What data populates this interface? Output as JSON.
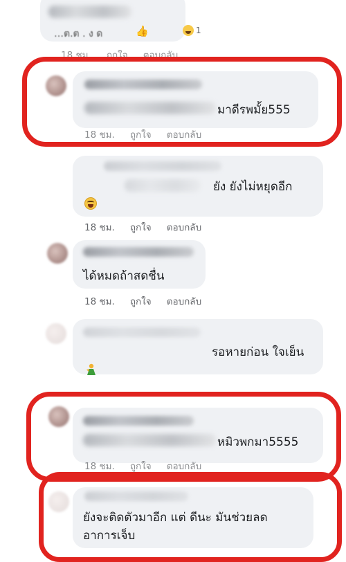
{
  "comments": [
    {
      "id": "c0",
      "text": "…ต.ต . ง ด",
      "emoji": "👍",
      "reaction_count": "1",
      "meta": {
        "time": "18 ชม.",
        "like": "ถูกใจ",
        "reply": "ตอบกลับ"
      }
    },
    {
      "id": "c1",
      "text": "มาดีรพมั้ย555",
      "meta": {
        "time": "18 ชม.",
        "like": "ถูกใจ",
        "reply": "ตอบกลับ"
      },
      "highlighted": true
    },
    {
      "id": "c2",
      "text": "ยัง ยังไม่หยุดอีก",
      "emoji_name": "laughing-face",
      "meta": {
        "time": "18 ชม.",
        "like": "ถูกใจ",
        "reply": "ตอบกลับ"
      }
    },
    {
      "id": "c3",
      "text": "ได้หมดถ้าสดชื่น",
      "meta": {
        "time": "18 ชม.",
        "like": "ถูกใจ",
        "reply": "ตอบกลับ"
      }
    },
    {
      "id": "c4",
      "text": "รอหายก่อน ใจเย็น",
      "emoji_name": "person-icon",
      "meta": {
        "time": "18 ชม.",
        "like": "ถูกใจ",
        "reply": "ตอบกลับ"
      }
    },
    {
      "id": "c5",
      "text": "หมิวพกมา5555",
      "meta": {
        "time": "18 ชม.",
        "like": "ถูกใจ",
        "reply": "ตอบกลับ"
      },
      "highlighted": true
    },
    {
      "id": "c6",
      "text_line1": "ยังจะติดตัวมาอีก แต่ ดีนะ มันช่วยลด",
      "text_line2": "อาการเจ็บ",
      "highlighted": true
    }
  ],
  "colors": {
    "highlight": "#e1231f",
    "bubble": "#eff1f4",
    "meta": "#65676b"
  }
}
